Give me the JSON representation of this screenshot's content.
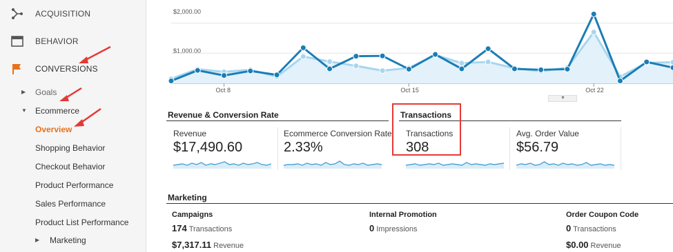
{
  "sidebar": {
    "items": [
      {
        "label": "ACQUISITION",
        "icon": "acquisition-icon"
      },
      {
        "label": "BEHAVIOR",
        "icon": "behavior-icon"
      },
      {
        "label": "CONVERSIONS",
        "icon": "flag-icon"
      }
    ],
    "conversions_sub": {
      "goals": "Goals",
      "ecommerce": "Ecommerce",
      "ecommerce_items": [
        "Overview",
        "Shopping Behavior",
        "Checkout Behavior",
        "Product Performance",
        "Sales Performance",
        "Product List Performance"
      ],
      "marketing": "Marketing"
    },
    "selected": "Overview",
    "accent_color": "#e8711a"
  },
  "chart_data": {
    "type": "line",
    "y_ticks": [
      "$2,000.00",
      "$1,000.00"
    ],
    "ylim": [
      0,
      2400
    ],
    "x_tick_labels": [
      {
        "label": "Oct 8",
        "index": 2
      },
      {
        "label": "Oct 15",
        "index": 9
      },
      {
        "label": "Oct 22",
        "index": 16
      }
    ],
    "series": [
      {
        "color": "#1a7db5",
        "values": [
          80,
          430,
          260,
          410,
          280,
          1180,
          480,
          900,
          910,
          470,
          960,
          480,
          1150,
          480,
          450,
          470,
          2300,
          80,
          710,
          520
        ]
      },
      {
        "color": "#a7d6f0",
        "values": [
          150,
          470,
          380,
          450,
          220,
          890,
          720,
          580,
          420,
          510,
          940,
          670,
          710,
          500,
          400,
          520,
          1700,
          220,
          680,
          700
        ]
      }
    ]
  },
  "summary": {
    "revenue_section_title": "Revenue & Conversion Rate",
    "transactions_section_title": "Transactions",
    "cards": [
      {
        "label": "Revenue",
        "value": "$17,490.60"
      },
      {
        "label": "Ecommerce Conversion Rate",
        "value": "2.33%"
      },
      {
        "label": "Transactions",
        "value": "308"
      },
      {
        "label": "Avg. Order Value",
        "value": "$56.79"
      }
    ],
    "highlight_color": "#e53935"
  },
  "marketing": {
    "title": "Marketing",
    "campaigns": {
      "title": "Campaigns",
      "count": "174",
      "count_unit": "Transactions",
      "revenue": "$7,317.11",
      "revenue_unit": "Revenue"
    },
    "internal_promotion": {
      "title": "Internal Promotion",
      "count": "0",
      "count_unit": "Impressions"
    },
    "order_coupon": {
      "title": "Order Coupon Code",
      "count": "0",
      "count_unit": "Transactions",
      "revenue": "$0.00",
      "revenue_unit": "Revenue"
    }
  }
}
